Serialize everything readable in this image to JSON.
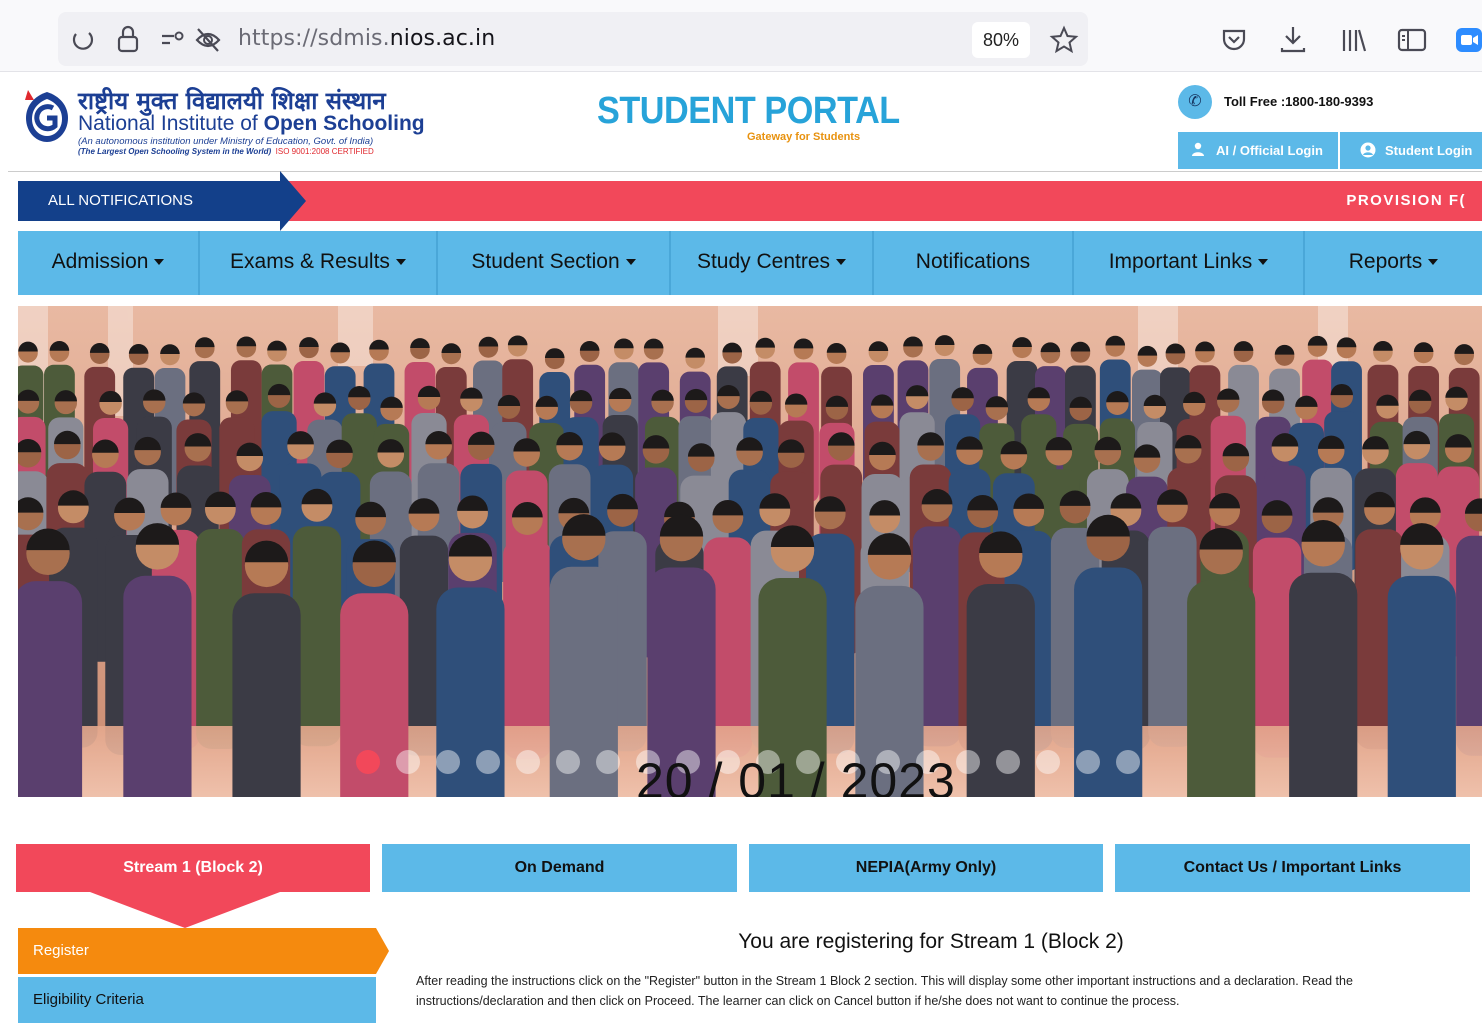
{
  "browser": {
    "url_prefix": "https://sdmis.",
    "url_domain": "nios.ac.in",
    "zoom": "80%"
  },
  "header": {
    "logo_hindi": "राष्ट्रीय मुक्त विद्यालयी शिक्षा संस्थान",
    "logo_en_prefix": "National Institute of ",
    "logo_en_bold": "Open Schooling",
    "logo_sub1": "(An autonomous institution under Ministry of Education, Govt. of India)",
    "logo_sub2": "(The Largest Open Schooling System in the World)",
    "logo_sub2_cert": "ISO 9001:2008 CERTIFIED",
    "portal_title": "STUDENT PORTAL",
    "portal_subtitle": "Gateway for Students",
    "toll_free": "Toll Free :1800-180-9393",
    "ai_login": "AI / Official Login",
    "student_login": "Student Login"
  },
  "notifications": {
    "tab_label": "ALL NOTIFICATIONS",
    "ticker": "PROVISION F("
  },
  "nav": [
    {
      "label": "Admission",
      "dropdown": true
    },
    {
      "label": "Exams & Results",
      "dropdown": true
    },
    {
      "label": "Student Section",
      "dropdown": true
    },
    {
      "label": "Study Centres",
      "dropdown": true
    },
    {
      "label": "Notifications",
      "dropdown": false
    },
    {
      "label": "Important Links",
      "dropdown": true
    },
    {
      "label": "Reports",
      "dropdown": true
    }
  ],
  "banner": {
    "date": "20 / 01 / 2023",
    "slide_count": 20,
    "active_slide": 1
  },
  "tabs": [
    {
      "label": "Stream 1 (Block 2)",
      "active": true
    },
    {
      "label": "On Demand",
      "active": false
    },
    {
      "label": "NEPIA(Army Only)",
      "active": false
    },
    {
      "label": "Contact Us / Important Links",
      "active": false
    }
  ],
  "side_menu": {
    "register": "Register",
    "eligibility": "Eligibility Criteria"
  },
  "content": {
    "title": "You are registering for Stream 1 (Block 2)",
    "text": "After reading the instructions click on the \"Register\" button in the Stream 1 Block 2 section. This will display some other important instructions and a declaration. Read the instructions/declaration and then click on Proceed. The learner can click on Cancel button if he/she does not want to continue the process."
  },
  "colors": {
    "accent_blue": "#5cb9e8",
    "navy": "#13408a",
    "red": "#f2485a",
    "orange": "#f58a0e"
  }
}
